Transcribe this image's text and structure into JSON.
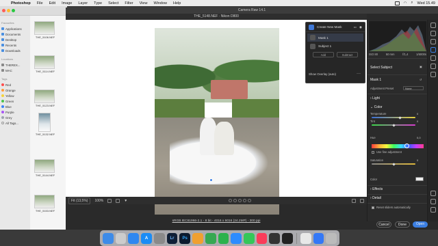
{
  "menubar": {
    "app": "Photoshop",
    "items": [
      "File",
      "Edit",
      "Image",
      "Layer",
      "Type",
      "Select",
      "Filter",
      "View",
      "Window",
      "Help"
    ],
    "clock": "Wed 15.49"
  },
  "finder": {
    "favourites_title": "Favourites",
    "favourites": [
      "Applications",
      "Documents",
      "Desktop",
      "Recents",
      "Downloads"
    ],
    "locations_title": "Locations",
    "locations": [
      "THEREX...",
      "MAC"
    ],
    "tags_title": "Tags",
    "tags": [
      {
        "label": "Red",
        "color": "#ff4d4d"
      },
      {
        "label": "Orange",
        "color": "#ff9a3c"
      },
      {
        "label": "Yellow",
        "color": "#f5d33a"
      },
      {
        "label": "Green",
        "color": "#4cc24c"
      },
      {
        "label": "Blue",
        "color": "#3b82f6"
      },
      {
        "label": "Purple",
        "color": "#a855f7"
      },
      {
        "label": "Grey",
        "color": "#9ca3af"
      },
      {
        "label": "All Tags...",
        "color": ""
      }
    ],
    "files": [
      "THE_5106.NEF",
      "THE_5114.NEF",
      "THE_5123.NEF",
      "THE_5132.NEF",
      "THE_5144.NEF",
      "THE_5153.NEF"
    ]
  },
  "camera_raw": {
    "window_title": "Camera Raw 14.1",
    "file_title": "THE_5148.NEF · Nikon D800",
    "zoom_label": "Fit (13,5%)",
    "zoom_pct": "100%",
    "bottom_link": "sRGB IEC61966-2.1 - 8 bit - 4016 x 6016 (24.2MP) - 300 ppi",
    "buttons": {
      "cancel": "Cancel",
      "done": "Done",
      "open": "Open"
    }
  },
  "masks_panel": {
    "create_new": "Create New Mask",
    "mask_name": "Mask 1",
    "subject_name": "Subject 1",
    "add": "Add",
    "subtract": "Subtract",
    "overlay": "Show Overlay (auto)"
  },
  "right_panel": {
    "info": {
      "iso": "ISO 80",
      "focal": "50 mm",
      "aperture": "f/1,4",
      "shutter": "1/6000s"
    },
    "select_subject": "Select Subject",
    "mask_title": "Mask 1",
    "adjustment_preset_label": "Adjustment Preset",
    "adjustment_preset_value": "None",
    "light": "Light",
    "color": "Color",
    "temperature": "Temperature",
    "temperature_value": "0",
    "temperature_pos": 0.65,
    "tint": "Tint",
    "tint_value": "0",
    "tint_pos": 0.5,
    "hue": "Hue",
    "hue_value": "0,0",
    "use_fine": "Use fine adjustment",
    "saturation": "Saturation",
    "saturation_value": "0",
    "saturation_pos": 0.5,
    "color_label": "Color",
    "effects": "Effects",
    "detail": "Detail",
    "reset": "Reset sliders automatically"
  },
  "dock": {
    "apps": [
      {
        "name": "finder",
        "label": "",
        "color": "#3d8be8"
      },
      {
        "name": "launchpad",
        "label": "",
        "color": "#cccccc"
      },
      {
        "name": "safari",
        "label": "",
        "color": "#2f87f0"
      },
      {
        "name": "appstore",
        "label": "A",
        "color": "#1b8cf5"
      },
      {
        "name": "settings",
        "label": "",
        "color": "#8a8a8a"
      },
      {
        "name": "lightroom",
        "label": "Lr",
        "color": "#0f1f36"
      },
      {
        "name": "photoshop",
        "label": "Ps",
        "color": "#0b1a2e"
      },
      {
        "name": "photos",
        "label": "",
        "color": "#f0a030"
      },
      {
        "name": "chrome",
        "label": "",
        "color": "#36a852"
      },
      {
        "name": "feedly",
        "label": "",
        "color": "#2bb24c"
      },
      {
        "name": "zoom",
        "label": "",
        "color": "#2d8cff"
      },
      {
        "name": "messages",
        "label": "",
        "color": "#34c759"
      },
      {
        "name": "music",
        "label": "",
        "color": "#fa3c5a"
      },
      {
        "name": "monitor",
        "label": "",
        "color": "#333333"
      },
      {
        "name": "terminal",
        "label": "",
        "color": "#222222"
      },
      {
        "name": "preview",
        "label": "",
        "color": "#e8e8e8"
      },
      {
        "name": "keynote",
        "label": "",
        "color": "#3478f6"
      },
      {
        "name": "trash",
        "label": "",
        "color": "#bbbbbb"
      }
    ]
  }
}
